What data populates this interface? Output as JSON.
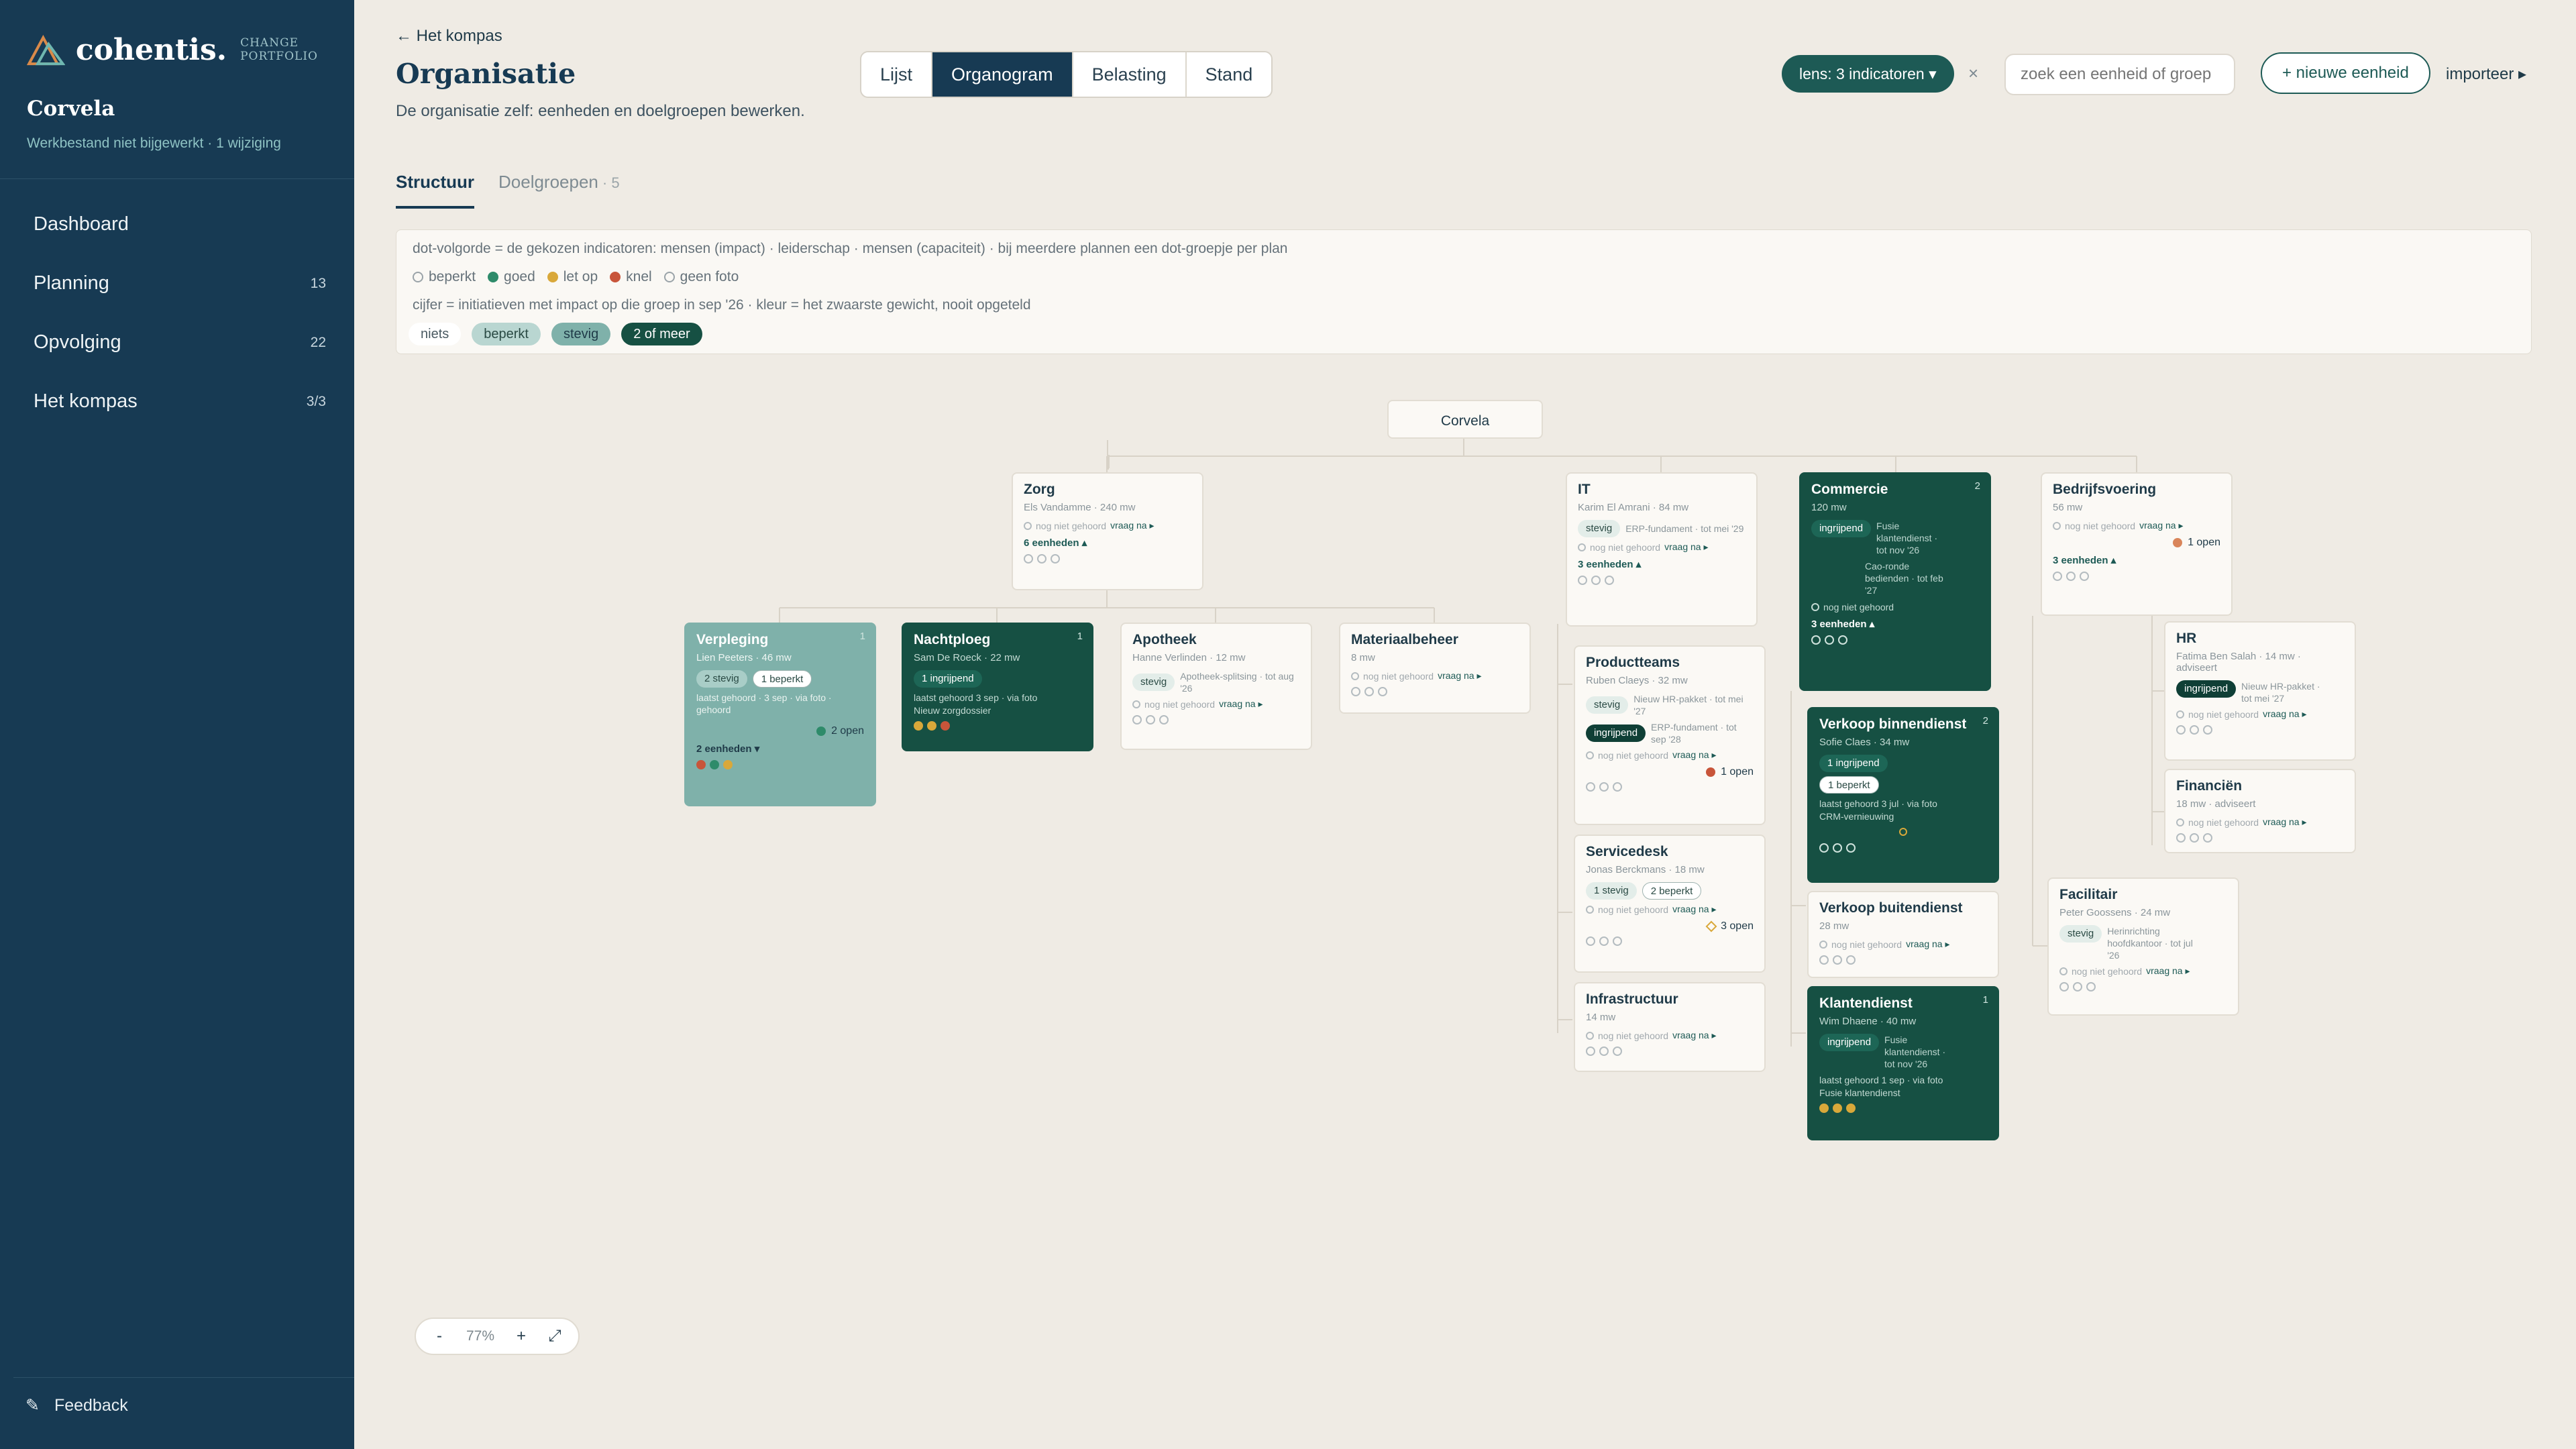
{
  "brand": {
    "name": "cohentis.",
    "subtitle": "CHANGE PORTFOLIO"
  },
  "org": {
    "name": "Corvela",
    "status": "Werkbestand niet bijgewerkt · 1 wijziging"
  },
  "nav": [
    {
      "label": "Dashboard",
      "count": ""
    },
    {
      "label": "Planning",
      "count": "13"
    },
    {
      "label": "Opvolging",
      "count": "22"
    },
    {
      "label": "Het kompas",
      "count": "3/3"
    }
  ],
  "feedback": {
    "icon": "✎",
    "label": "Feedback"
  },
  "header": {
    "back": "← Het kompas",
    "title": "Organisatie",
    "subtitle": "De organisatie zelf: eenheden en doelgroepen bewerken."
  },
  "view_tabs": [
    "Lijst",
    "Organogram",
    "Belasting",
    "Stand"
  ],
  "active_view": "Organogram",
  "lens": "lens: 3 indicatoren ▾",
  "lens_clear": "×",
  "search": {
    "placeholder": "zoek een eenheid of groep"
  },
  "new_button": "+ nieuwe eenheid",
  "import": "importeer ▸",
  "subtabs": [
    {
      "label": "Structuur",
      "count": ""
    },
    {
      "label": "Doelgroepen",
      "count": "· 5"
    }
  ],
  "legend": {
    "line1": "dot-volgorde = de gekozen indicatoren: mensen (impact) · leiderschap · mensen (capaciteit) · bij meerdere plannen een dot-groepje per plan",
    "items": [
      {
        "label": "beperkt",
        "color": ""
      },
      {
        "label": "goed",
        "color": "#2e8b6a"
      },
      {
        "label": "let op",
        "color": "#d9a83a"
      },
      {
        "label": "knel",
        "color": "#c8553a"
      },
      {
        "label": "geen foto",
        "color": ""
      }
    ],
    "line3": "cijfer = initiatieven met impact op die groep in sep '26 · kleur = het zwaarste gewicht, nooit opgeteld",
    "chips": [
      "niets",
      "beperkt",
      "stevig",
      "2 of meer"
    ]
  },
  "nodes": {
    "root": {
      "title": "Corvela"
    },
    "zorg": {
      "title": "Zorg",
      "meta": "Els Vandamme · 240 mw",
      "nog": "nog niet gehoord",
      "vr": "vraag na ▸",
      "more": "6 eenheden ▴"
    },
    "verpleging": {
      "title": "Verpleging",
      "meta": "Lien Peeters · 46 mw",
      "num": "1",
      "t1": "2 stevig",
      "t2": "1 beperkt",
      "ini": "laatst gehoord · 3 sep · via foto · gehoord",
      "open": "2 open",
      "more": "2 eenheden ▾"
    },
    "nachtploeg": {
      "title": "Nachtploeg",
      "meta": "Sam De Roeck · 22 mw",
      "num": "1",
      "t1": "1 ingrijpend",
      "last": "laatst gehoord 3 sep · via foto",
      "last2": "Nieuw zorgdossier"
    },
    "apotheek": {
      "title": "Apotheek",
      "meta": "Hanne Verlinden · 12 mw",
      "t1": "stevig",
      "ini": "Apotheek-splitsing · tot aug '26",
      "nog": "nog niet gehoord",
      "vr": "vraag na ▸"
    },
    "materiaal": {
      "title": "Materiaalbeheer",
      "meta": "8 mw",
      "nog": "nog niet gehoord",
      "vr": "vraag na ▸"
    },
    "it": {
      "title": "IT",
      "meta": "Karim El Amrani · 84 mw",
      "t1": "stevig",
      "ini": "ERP-fundament · tot mei '29",
      "nog": "nog niet gehoord",
      "vr": "vraag na ▸",
      "more": "3 eenheden ▴"
    },
    "productteams": {
      "title": "Productteams",
      "meta": "Ruben Claeys · 32 mw",
      "t1": "stevig",
      "ini1": "Nieuw HR-pakket · tot mei '27",
      "t2": "ingrijpend",
      "ini2": "ERP-fundament · tot sep '28",
      "nog": "nog niet gehoord",
      "vr": "vraag na ▸",
      "open": "1 open"
    },
    "servicedesk": {
      "title": "Servicedesk",
      "meta": "Jonas Berckmans · 18 mw",
      "t1": "1 stevig",
      "t2": "2 beperkt",
      "nog": "nog niet gehoord",
      "vr": "vraag na ▸",
      "open": "3 open"
    },
    "infra": {
      "title": "Infrastructuur",
      "meta": "14 mw",
      "nog": "nog niet gehoord",
      "vr": "vraag na ▸"
    },
    "commercie": {
      "title": "Commercie",
      "meta": "120 mw",
      "num": "2",
      "t1": "ingrijpend",
      "ini1": "Fusie klantendienst · tot nov '26",
      "ini2": "Cao-ronde bedienden · tot feb '27",
      "nog": "nog niet gehoord",
      "more": "3 eenheden ▴"
    },
    "vbinnen": {
      "title": "Verkoop binnendienst",
      "meta": "Sofie Claes · 34 mw",
      "num": "2",
      "t1": "1 ingrijpend",
      "t2": "1 beperkt",
      "last": "laatst gehoord 3 jul · via foto",
      "last2": "CRM-vernieuwing"
    },
    "vbuiten": {
      "title": "Verkoop buitendienst",
      "meta": "28 mw",
      "nog": "nog niet gehoord",
      "vr": "vraag na ▸"
    },
    "klanten": {
      "title": "Klantendienst",
      "meta": "Wim Dhaene · 40 mw",
      "num": "1",
      "t1": "ingrijpend",
      "ini": "Fusie klantendienst · tot nov '26",
      "last": "laatst gehoord 1 sep · via foto",
      "last2": "Fusie klantendienst"
    },
    "bedrijf": {
      "title": "Bedrijfsvoering",
      "meta": "56 mw",
      "nog": "nog niet gehoord",
      "vr": "vraag na ▸",
      "open": "1 open",
      "more": "3 eenheden ▴"
    },
    "hr": {
      "title": "HR",
      "meta": "Fatima Ben Salah · 14 mw · adviseert",
      "t1": "ingrijpend",
      "ini": "Nieuw HR-pakket · tot mei '27",
      "nog": "nog niet gehoord",
      "vr": "vraag na ▸"
    },
    "financien": {
      "title": "Financiën",
      "meta": "18 mw · adviseert",
      "nog": "nog niet gehoord",
      "vr": "vraag na ▸"
    },
    "facilitair": {
      "title": "Facilitair",
      "meta": "Peter Goossens · 24 mw",
      "t1": "stevig",
      "ini": "Herinrichting hoofdkantoor · tot jul '26",
      "nog": "nog niet gehoord",
      "vr": "vraag na ▸"
    }
  },
  "zoom": {
    "minus": "-",
    "value": "77%",
    "plus": "+",
    "fit": "⤢"
  }
}
